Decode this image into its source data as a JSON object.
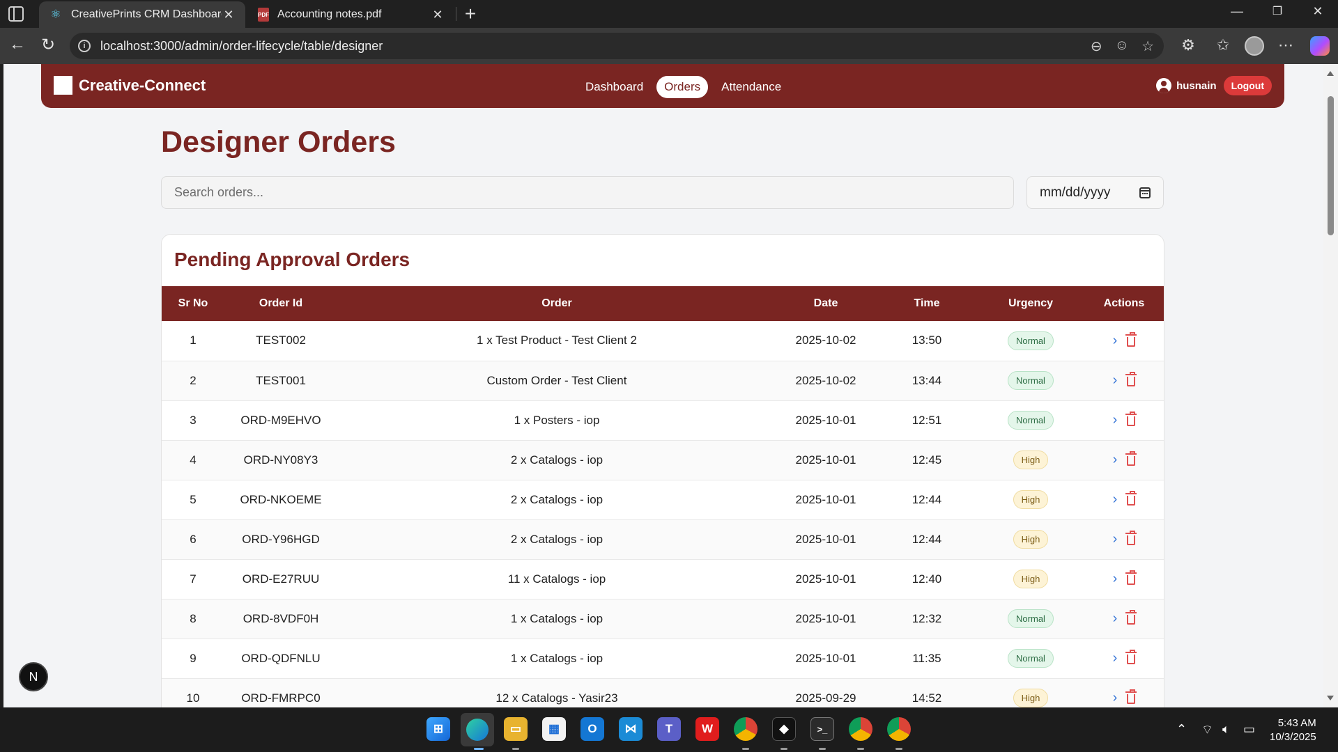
{
  "browser": {
    "tabs": [
      {
        "title": "CreativePrints CRM Dashboard",
        "icon": "react-icon",
        "active": true
      },
      {
        "title": "Accounting notes.pdf",
        "icon": "pdf-icon",
        "active": false
      }
    ],
    "url": "localhost:3000/admin/order-lifecycle/table/designer"
  },
  "app": {
    "brand": "Creative-Connect",
    "nav": {
      "dashboard": "Dashboard",
      "orders": "Orders",
      "attendance": "Attendance",
      "active": "Orders"
    },
    "user": {
      "name": "husnain",
      "logout": "Logout"
    },
    "colors": {
      "primary": "#7a2522",
      "logout": "#dc3a3a",
      "normal_badge": "#e4f6ea",
      "high_badge": "#fdf3d6"
    }
  },
  "page": {
    "title": "Designer Orders",
    "search_placeholder": "Search orders...",
    "date_placeholder": "mm/dd/yyyy"
  },
  "pending": {
    "title": "Pending Approval Orders",
    "columns": {
      "sr": "Sr No",
      "id": "Order Id",
      "order": "Order",
      "date": "Date",
      "time": "Time",
      "urgency": "Urgency",
      "actions": "Actions"
    },
    "rows": [
      {
        "sr": "1",
        "id": "TEST002",
        "order": "1 x Test Product - Test Client 2",
        "date": "2025-10-02",
        "time": "13:50",
        "urgency": "Normal"
      },
      {
        "sr": "2",
        "id": "TEST001",
        "order": "Custom Order - Test Client",
        "date": "2025-10-02",
        "time": "13:44",
        "urgency": "Normal"
      },
      {
        "sr": "3",
        "id": "ORD-M9EHVO",
        "order": "1 x Posters - iop",
        "date": "2025-10-01",
        "time": "12:51",
        "urgency": "Normal"
      },
      {
        "sr": "4",
        "id": "ORD-NY08Y3",
        "order": "2 x Catalogs - iop",
        "date": "2025-10-01",
        "time": "12:45",
        "urgency": "High"
      },
      {
        "sr": "5",
        "id": "ORD-NKOEME",
        "order": "2 x Catalogs - iop",
        "date": "2025-10-01",
        "time": "12:44",
        "urgency": "High"
      },
      {
        "sr": "6",
        "id": "ORD-Y96HGD",
        "order": "2 x Catalogs - iop",
        "date": "2025-10-01",
        "time": "12:44",
        "urgency": "High"
      },
      {
        "sr": "7",
        "id": "ORD-E27RUU",
        "order": "11 x Catalogs - iop",
        "date": "2025-10-01",
        "time": "12:40",
        "urgency": "High"
      },
      {
        "sr": "8",
        "id": "ORD-8VDF0H",
        "order": "1 x Catalogs - iop",
        "date": "2025-10-01",
        "time": "12:32",
        "urgency": "Normal"
      },
      {
        "sr": "9",
        "id": "ORD-QDFNLU",
        "order": "1 x Catalogs - iop",
        "date": "2025-10-01",
        "time": "11:35",
        "urgency": "Normal"
      },
      {
        "sr": "10",
        "id": "ORD-FMRPC0",
        "order": "12 x Catalogs - Yasir23",
        "date": "2025-09-29",
        "time": "14:52",
        "urgency": "High"
      }
    ]
  },
  "dev_badge": "N",
  "taskbar": {
    "time": "5:43 AM",
    "date": "10/3/2025"
  }
}
